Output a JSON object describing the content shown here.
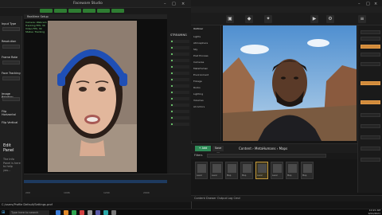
{
  "left_app": {
    "title": "Faceware Studio",
    "tabs": [
      "",
      "",
      "",
      "",
      "",
      ""
    ],
    "side_panel": [
      {
        "label": "Input Type",
        "value": ""
      },
      {
        "label": "Resolution",
        "value": ""
      },
      {
        "label": "Frame Rate",
        "value": ""
      },
      {
        "label": "Face Tracking",
        "value": ""
      },
      {
        "label": "Image Rotation",
        "value": ""
      },
      {
        "label": "Flip Horizontal",
        "value": ""
      },
      {
        "label": "Flip Vertical",
        "value": ""
      }
    ],
    "bottom_panel": {
      "heading": "Edit Panel",
      "body": "The Info Panel is here to help you..."
    },
    "video_header": "Realtime Setup",
    "stats": [
      "Camera: Webcam",
      "Tracking FPS: 30",
      "Video FPS: 30",
      "Status: Tracking"
    ],
    "right_list_header": "STREAMING",
    "timeline_labels": [
      "200",
      "1006",
      "1200",
      "2000"
    ],
    "file_path": "C:/users/Profile Default/Settings.prof"
  },
  "ue": {
    "outliner_items": [
      "Outliner",
      "Lights",
      "Atmosphere",
      "Sky",
      "Post Process",
      "Cameras",
      "MetaHuman",
      "Environment",
      "Foliage",
      "Rocks",
      "Lighting",
      "Volumes",
      "All Actors"
    ],
    "cb_add": "+ Add",
    "cb_import": "Import",
    "cb_save": "Save All",
    "breadcrumb": "Content  ›  MetaHumans  ›  Maps",
    "filters": "Filters",
    "assets": [
      {
        "label": "Level",
        "selected": false
      },
      {
        "label": "Level",
        "selected": false
      },
      {
        "label": "Map",
        "selected": false
      },
      {
        "label": "Map",
        "selected": false
      },
      {
        "label": "Level",
        "selected": true
      },
      {
        "label": "Level",
        "selected": false
      },
      {
        "label": "Map",
        "selected": false
      },
      {
        "label": "Map",
        "selected": false
      }
    ],
    "status": "Content Drawer   Output Log   Cmd"
  },
  "taskbar": {
    "search_placeholder": "Type here to search",
    "time": "10:21 AM",
    "date": "9/21/2021"
  },
  "colors": {
    "ue_accent": "#2e8b57",
    "fw_tab": "#2e7d32",
    "details_highlight": "#d08a3a"
  }
}
